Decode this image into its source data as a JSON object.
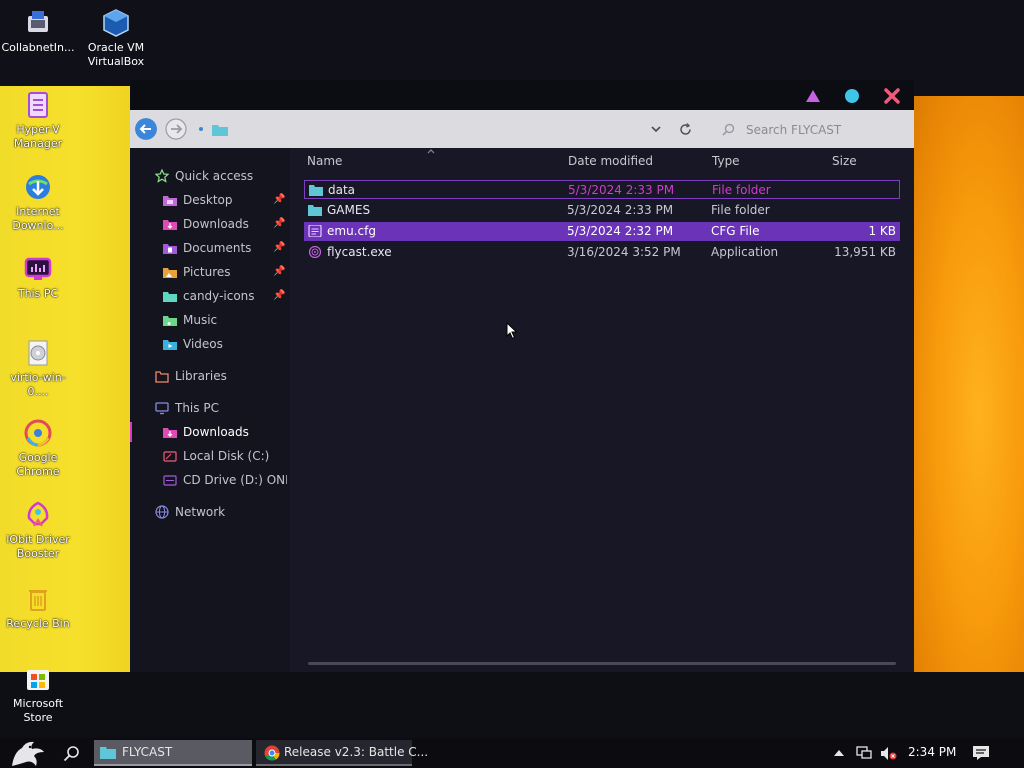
{
  "desktop": {
    "icons": [
      {
        "label": "CollabnetIn..."
      },
      {
        "label": "Oracle VM VirtualBox"
      },
      {
        "label": "Hyper-V Manager"
      },
      {
        "label": "Internet Downlo..."
      },
      {
        "label": "This PC"
      },
      {
        "label": "virtio-win-0...."
      },
      {
        "label": "Google Chrome"
      },
      {
        "label": "IObit Driver Booster"
      },
      {
        "label": "Recycle Bin"
      },
      {
        "label": "Microsoft Store"
      }
    ]
  },
  "window": {
    "title": "FLYCAST",
    "controls": {
      "minimize": "triangle",
      "maximize": "circle",
      "close": "x"
    },
    "colors": {
      "minimize": "#c462e0",
      "maximize": "#3ec5e8",
      "close": "#f05a7a"
    }
  },
  "address": {
    "search_placeholder": "Search FLYCAST"
  },
  "sidebar": {
    "quick_access": "Quick access",
    "quick_items": [
      {
        "label": "Desktop",
        "pinned": true
      },
      {
        "label": "Downloads",
        "pinned": true
      },
      {
        "label": "Documents",
        "pinned": true
      },
      {
        "label": "Pictures",
        "pinned": true
      },
      {
        "label": "candy-icons",
        "pinned": true
      },
      {
        "label": "Music",
        "pinned": false
      },
      {
        "label": "Videos",
        "pinned": false
      }
    ],
    "libraries": "Libraries",
    "this_pc": "This PC",
    "pc_items": [
      {
        "label": "Downloads"
      },
      {
        "label": "Local Disk (C:)"
      },
      {
        "label": "CD Drive (D:) ONE_I"
      }
    ],
    "network": "Network"
  },
  "filelist": {
    "columns": {
      "name": "Name",
      "date": "Date modified",
      "type": "Type",
      "size": "Size"
    },
    "rows": [
      {
        "name": "data",
        "date": "5/3/2024 2:33 PM",
        "type": "File folder",
        "size": ""
      },
      {
        "name": "GAMES",
        "date": "5/3/2024 2:33 PM",
        "type": "File folder",
        "size": ""
      },
      {
        "name": "emu.cfg",
        "date": "5/3/2024 2:32 PM",
        "type": "CFG File",
        "size": "1 KB"
      },
      {
        "name": "flycast.exe",
        "date": "3/16/2024 3:52 PM",
        "type": "Application",
        "size": "13,951 KB"
      }
    ],
    "colors": {
      "focus_border": "#7c3fc4",
      "selected_bg": "#6a33b8",
      "magenta_text": "#d23ad0"
    }
  },
  "taskbar": {
    "explorer_label": "FLYCAST",
    "chrome_label": "Release v2.3: Battle C...",
    "clock": "2:34 PM"
  }
}
